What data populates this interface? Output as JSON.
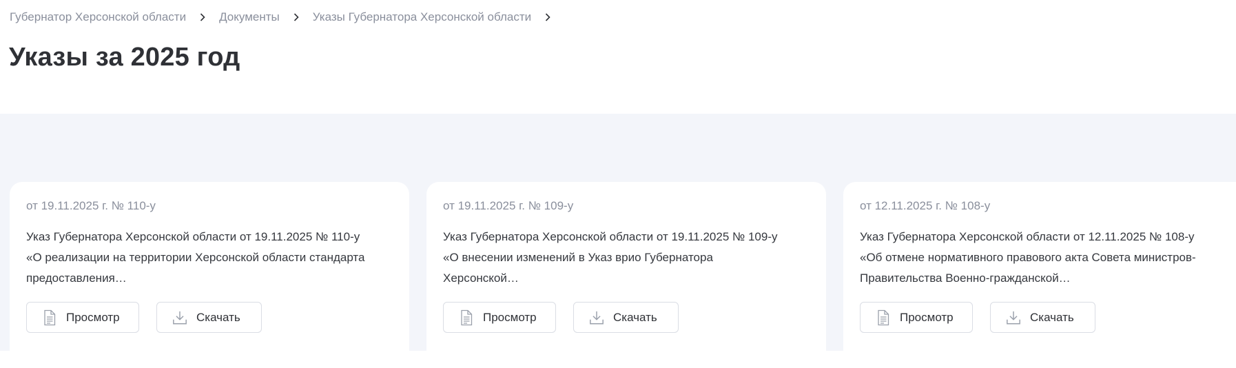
{
  "breadcrumb": [
    {
      "label": "Губернатор Херсонской области"
    },
    {
      "label": "Документы"
    },
    {
      "label": "Указы Губернатора Херсонской области"
    }
  ],
  "page_title": "Указы за 2025 год",
  "cards": [
    {
      "date": "от 19.11.2025 г. № 110-у",
      "line1": "Указ Губернатора Херсонской области от 19.11.2025 № 110-у",
      "line2": "«О реализации на территории Херсонской области стандарта",
      "line3": "предоставления…",
      "view_label": "Просмотр",
      "download_label": "Скачать"
    },
    {
      "date": "от 19.11.2025 г. № 109-у",
      "line1": "Указ Губернатора Херсонской области от 19.11.2025 № 109-у",
      "line2": "«О внесении изменений в Указ врио Губернатора",
      "line3": "Херсонской…",
      "view_label": "Просмотр",
      "download_label": "Скачать"
    },
    {
      "date": "от 12.11.2025 г. № 108-у",
      "line1": "Указ Губернатора Херсонской области от 12.11.2025 № 108-у",
      "line2": "«Об отмене нормативного правового акта Совета министров-",
      "line3": "Правительства Военно-гражданской…",
      "view_label": "Просмотр",
      "download_label": "Скачать"
    }
  ],
  "colors": {
    "page_background": "#ffffff",
    "section_background": "#f3f5fa",
    "muted_text": "#8a8f9c",
    "body_text": "#35383e",
    "title_text": "#2f3136",
    "button_border": "#dadde4",
    "icon_grey": "#9aa0ab"
  },
  "icons": {
    "separator": "chevron-right-icon",
    "view": "document-icon",
    "download": "download-icon"
  }
}
